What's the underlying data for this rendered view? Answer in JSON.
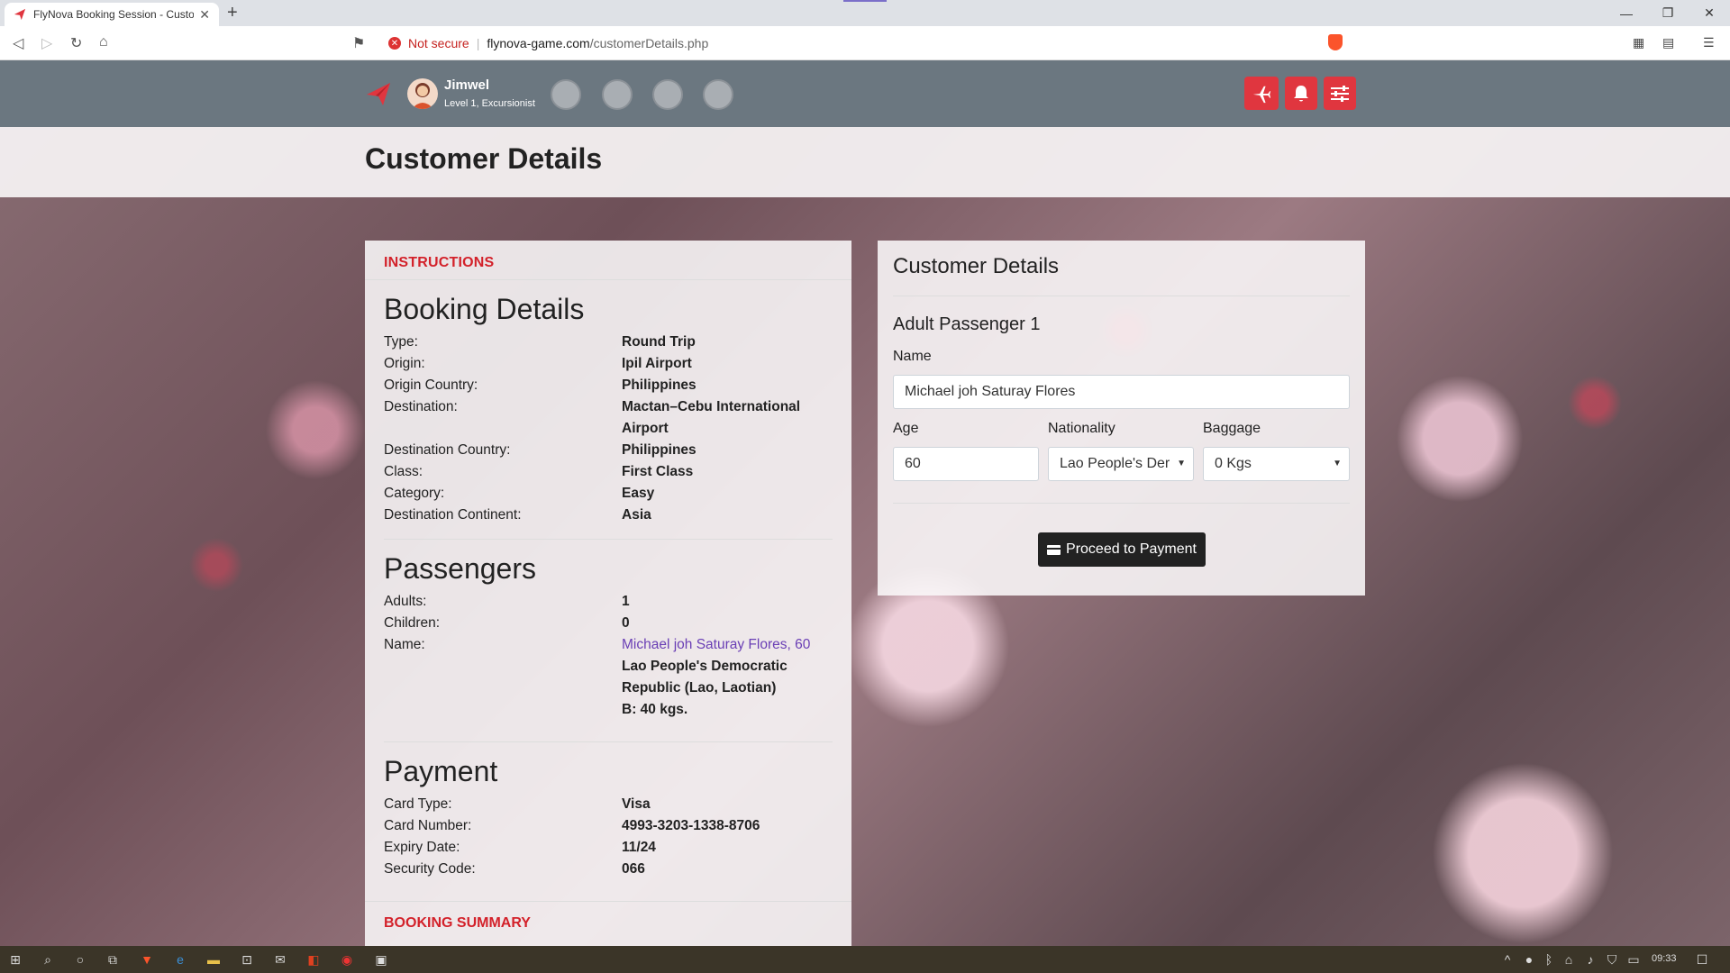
{
  "browser": {
    "tab_title": "FlyNova Booking Session - Custom",
    "tab_close": "✕",
    "new_tab": "+",
    "not_secure": "Not secure",
    "url_host": "flynova-game.com",
    "url_path": "/customerDetails.php",
    "window_controls": [
      "—",
      "❐",
      "✕"
    ]
  },
  "navbar": {
    "username": "Jimwel",
    "level": "Level 1, Excursionist"
  },
  "page": {
    "title": "Customer Details"
  },
  "instructions_label": "INSTRUCTIONS",
  "booking_details": {
    "heading": "Booking Details",
    "rows": [
      {
        "k": "Type:",
        "v": "Round Trip"
      },
      {
        "k": "Origin:",
        "v": "Ipil Airport"
      },
      {
        "k": "Origin Country:",
        "v": "Philippines"
      },
      {
        "k": "Destination:",
        "v": "Mactan–Cebu International Airport"
      },
      {
        "k": "Destination Country:",
        "v": "Philippines"
      },
      {
        "k": "Class:",
        "v": "First Class"
      },
      {
        "k": "Category:",
        "v": "Easy"
      },
      {
        "k": "Destination Continent:",
        "v": "Asia"
      }
    ]
  },
  "passengers": {
    "heading": "Passengers",
    "adults_k": "Adults:",
    "adults_v": "1",
    "children_k": "Children:",
    "children_v": "0",
    "name_k": "Name:",
    "name_link": "Michael joh Saturay Flores, 60",
    "nationality": "Lao People's Democratic Republic (Lao, Laotian)",
    "baggage": "B: 40 kgs."
  },
  "payment": {
    "heading": "Payment",
    "rows": [
      {
        "k": "Card Type:",
        "v": "Visa"
      },
      {
        "k": "Card Number:",
        "v": "4993-3203-1338-8706"
      },
      {
        "k": "Expiry Date:",
        "v": "11/24"
      },
      {
        "k": "Security Code:",
        "v": "066"
      }
    ]
  },
  "booking_summary_label": "BOOKING SUMMARY",
  "form": {
    "title": "Customer Details",
    "passenger_heading": "Adult Passenger 1",
    "name_label": "Name",
    "name_value": "Michael joh Saturay Flores",
    "age_label": "Age",
    "age_value": "60",
    "nationality_label": "Nationality",
    "nationality_value": "Lao People's Der",
    "baggage_label": "Baggage",
    "baggage_value": "0 Kgs",
    "proceed_label": "Proceed to Payment"
  },
  "taskbar": {
    "clock": "09:33"
  },
  "colors": {
    "accent_red": "#e0363f",
    "nav_bg": "#6b7780",
    "link_purple": "#6a3fb5"
  }
}
